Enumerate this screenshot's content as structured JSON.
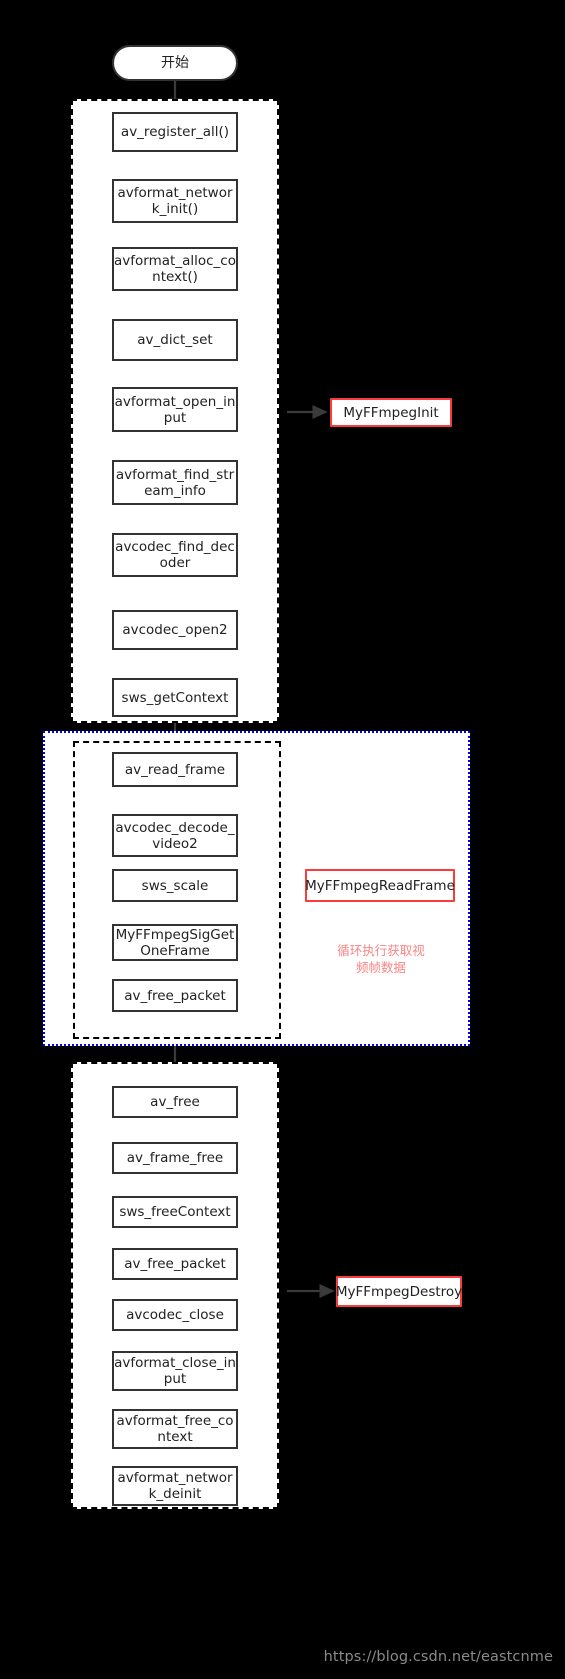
{
  "diagram": {
    "title_node": {
      "label": "开始",
      "shape": "terminator"
    },
    "watermark": "https://blog.csdn.net/eastcnme",
    "colors": {
      "background": "#000000",
      "group_fill": "#ffffff",
      "node_border": "#333333",
      "callout_border": "#fa3c3c",
      "loop_group_border": "#0000ff",
      "annotation_text": "#fa8484",
      "watermark_text": "#8a8a8a"
    },
    "groups": [
      {
        "id": "init",
        "border_style": "dashed",
        "border_color": "#000000",
        "callout": "MyFFmpegInit",
        "nodes": [
          "av_register_all()",
          "avformat_network_init()",
          "avformat_alloc_context()",
          "av_dict_set",
          "avformat_open_input",
          "avformat_find_stream_info",
          "avcodec_find_decoder",
          "avcodec_open2",
          "sws_getContext"
        ]
      },
      {
        "id": "loop",
        "border_style": "dotted",
        "border_color": "#0000ff",
        "inner_border_style": "dash-dot",
        "callout": "MyFFmpegReadFrame",
        "annotation": "循环执行获取视\n频帧数据",
        "nodes": [
          "av_read_frame",
          "avcodec_decode_video2",
          "sws_scale",
          "MyFFmpegSigGetOneFrame",
          "av_free_packet"
        ]
      },
      {
        "id": "destroy",
        "border_style": "dashed",
        "border_color": "#000000",
        "callout": "MyFFmpegDestroy",
        "nodes": [
          "av_free",
          "av_frame_free",
          "sws_freeContext",
          "av_free_packet",
          "avcodec_close",
          "avformat_close_input",
          "avformat_free_context",
          "avformat_network_deinit"
        ]
      }
    ],
    "node_labels": {
      "start": "开始",
      "av_register_all": "av_register_all()",
      "avformat_network_init": "avformat_networ\nk_init()",
      "avformat_alloc_context": "avformat_alloc_co\nntext()",
      "av_dict_set": "av_dict_set",
      "avformat_open_input": "avformat_open_in\nput",
      "avformat_find_stream_info": "avformat_find_str\neam_info",
      "avcodec_find_decoder": "avcodec_find_dec\noder",
      "avcodec_open2": "avcodec_open2",
      "sws_getContext": "sws_getContext",
      "av_read_frame": "av_read_frame",
      "avcodec_decode_video2": "avcodec_decode_\nvideo2",
      "sws_scale": "sws_scale",
      "myffmpeg_sig_get_one_frame": "MyFFmpegSigGet\nOneFrame",
      "av_free_packet_loop": "av_free_packet",
      "av_free": "av_free",
      "av_frame_free": "av_frame_free",
      "sws_freeContext": "sws_freeContext",
      "av_free_packet_destroy": "av_free_packet",
      "avcodec_close": "avcodec_close",
      "avformat_close_input": "avformat_close_in\nput",
      "avformat_free_context": "avformat_free_co\nntext",
      "avformat_network_deinit": "avformat_networ\nk_deinit"
    },
    "callouts": {
      "init": "MyFFmpegInit",
      "read_frame": "MyFFmpegReadFrame",
      "destroy": "MyFFmpegDestroy"
    },
    "annotations": {
      "loop_note": "循环执行获取视\n频帧数据"
    }
  }
}
